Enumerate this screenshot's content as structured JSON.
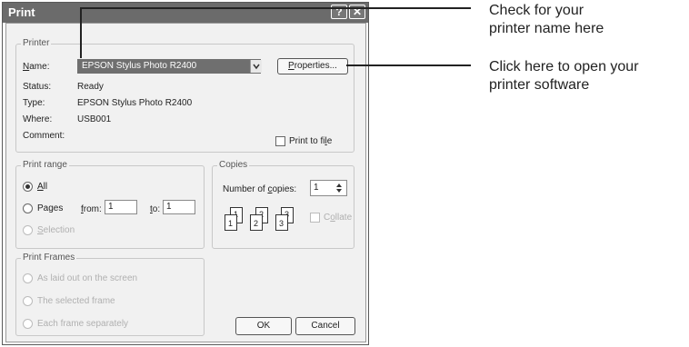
{
  "dialog": {
    "title": "Print",
    "help_glyph": "?",
    "close_glyph": "✕"
  },
  "printer": {
    "legend": "Printer",
    "name_label": "Name:",
    "name_value": "EPSON Stylus Photo R2400",
    "properties_label": "Properties...",
    "status_label": "Status:",
    "status_value": "Ready",
    "type_label": "Type:",
    "type_value": "EPSON Stylus Photo R2400",
    "where_label": "Where:",
    "where_value": "USB001",
    "comment_label": "Comment:",
    "print_to_file_label": "Print to file"
  },
  "print_range": {
    "legend": "Print range",
    "all_label": "All",
    "pages_label": "Pages",
    "from_label": "from:",
    "from_value": "1",
    "to_label": "to:",
    "to_value": "1",
    "selection_label": "Selection"
  },
  "copies": {
    "legend": "Copies",
    "number_label": "Number of copies:",
    "number_value": "1",
    "collate_label": "Collate",
    "collate_icons": [
      "1",
      "1",
      "2",
      "2",
      "3",
      "3"
    ]
  },
  "print_frames": {
    "legend": "Print Frames",
    "options": [
      "As laid out on the screen",
      "The selected frame",
      "Each frame separately"
    ]
  },
  "buttons": {
    "ok": "OK",
    "cancel": "Cancel"
  },
  "callouts": {
    "printer_name": "Check for your printer name here",
    "printer_name_line1": "Check for your",
    "printer_name_line2": "printer name here",
    "open_software_line1": "Click here to open your",
    "open_software_line2": "printer software"
  },
  "colors": {
    "titlebar": "#6b6b6b",
    "dialog_body": "#f1f1f1",
    "selected_combo": "#6f6f6f"
  }
}
